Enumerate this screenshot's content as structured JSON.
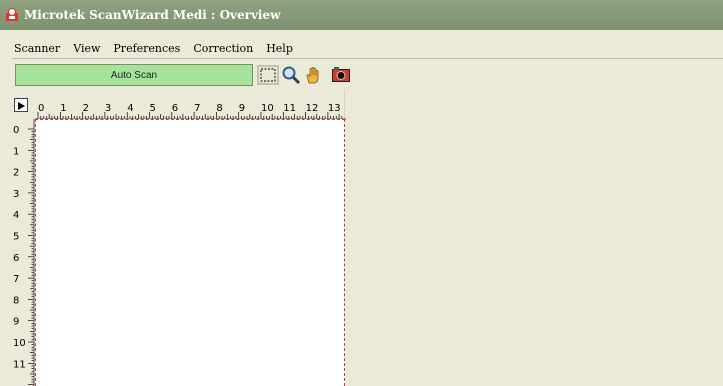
{
  "window": {
    "title": "Microtek ScanWizard Medi : Overview"
  },
  "menu": {
    "items": [
      "Scanner",
      "View",
      "Preferences",
      "Correction",
      "Help"
    ]
  },
  "toolbar": {
    "auto_scan_label": "Auto Scan",
    "tools": [
      "select-area-icon",
      "zoom-icon",
      "hand-pan-icon",
      "camera-icon"
    ]
  },
  "rulers": {
    "top_labels": [
      "0",
      "1",
      "2",
      "3",
      "4",
      "5",
      "6",
      "7",
      "8",
      "9",
      "10",
      "11",
      "12",
      "13"
    ],
    "left_labels": [
      "0",
      "1",
      "2",
      "3",
      "4",
      "5",
      "6",
      "7",
      "8",
      "9",
      "10",
      "11"
    ]
  },
  "colors": {
    "title_bar": "#8fa17f",
    "auto_scan_bg": "#a6e39a",
    "scan_frame": "#c23b3b",
    "canvas_bg": "#ffffff",
    "window_bg": "#ebe9d8"
  }
}
